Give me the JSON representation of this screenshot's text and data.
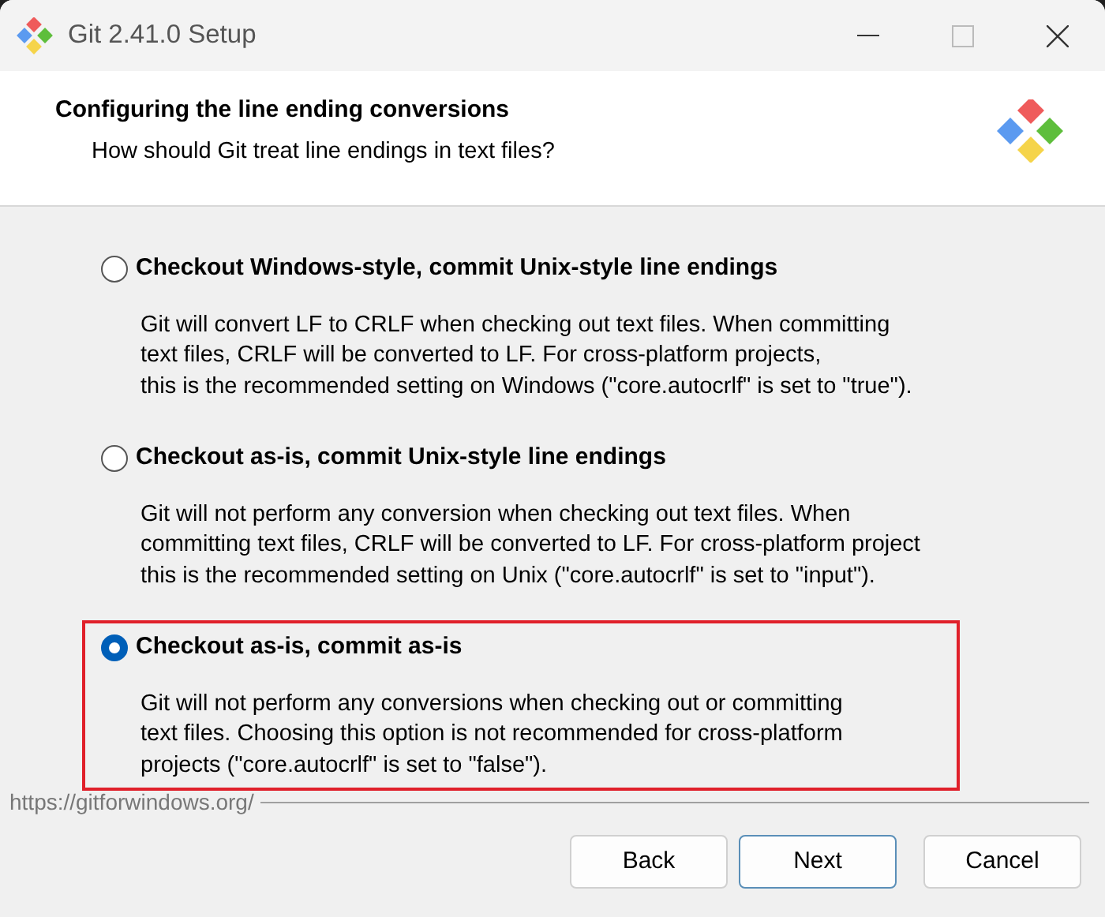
{
  "window": {
    "title": "Git 2.41.0 Setup"
  },
  "header": {
    "title": "Configuring the line ending conversions",
    "subtitle": "How should Git treat line endings in text files?"
  },
  "options": [
    {
      "label": "Checkout Windows-style, commit Unix-style line endings",
      "selected": false,
      "highlighted": false,
      "description": [
        "Git will convert LF to CRLF when checking out text files. When committing",
        "text files, CRLF will be converted to LF. For cross-platform projects,",
        "this is the recommended setting on Windows (\"core.autocrlf\" is set to \"true\")."
      ]
    },
    {
      "label": "Checkout as-is, commit Unix-style line endings",
      "selected": false,
      "highlighted": false,
      "description": [
        "Git will not perform any conversion when checking out text files. When",
        "committing text files, CRLF will be converted to LF. For cross-platform project",
        "this is the recommended setting on Unix (\"core.autocrlf\" is set to \"input\")."
      ]
    },
    {
      "label": "Checkout as-is, commit as-is",
      "selected": true,
      "highlighted": true,
      "description": [
        "Git will not perform any conversions when checking out or committing",
        "text files. Choosing this option is not recommended for cross-platform",
        "projects (\"core.autocrlf\" is set to \"false\")."
      ]
    }
  ],
  "footer": {
    "link": "https://gitforwindows.org/"
  },
  "buttons": [
    {
      "label": "Back",
      "default": false
    },
    {
      "label": "Next",
      "default": true
    },
    {
      "label": "Cancel",
      "default": false
    }
  ]
}
